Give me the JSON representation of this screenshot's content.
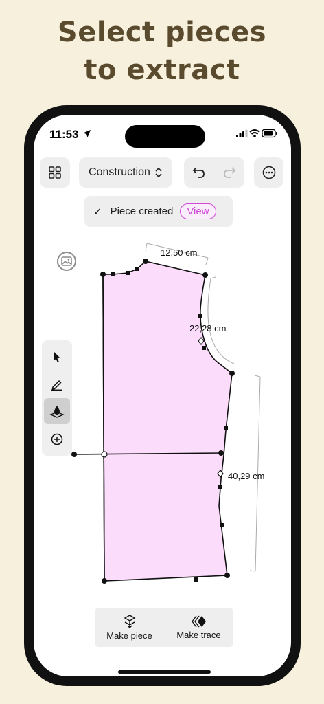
{
  "headline": {
    "line1": "Select pieces",
    "line2": "to extract"
  },
  "status_bar": {
    "time": "11:53"
  },
  "toolbar": {
    "mode_label": "Construction"
  },
  "toast": {
    "message": "Piece created",
    "view_label": "View"
  },
  "measurements": {
    "shoulder": "12,50 cm",
    "armhole": "22,28 cm",
    "side": "40,29 cm"
  },
  "bottom_actions": {
    "make_piece": "Make piece",
    "make_trace": "Make trace"
  },
  "colors": {
    "accent": "#d24ad8",
    "piece_fill": "#fbdcfb",
    "headline": "#5a4a2e",
    "background": "#f6f0dc"
  },
  "icons": [
    "location-arrow-icon",
    "signal-icon",
    "wifi-icon",
    "battery-icon",
    "grid-icon",
    "chevron-updown-icon",
    "undo-icon",
    "redo-icon",
    "more-icon",
    "checkmark-icon",
    "image-icon",
    "pointer-icon",
    "pencil-icon",
    "fill-icon",
    "add-icon",
    "make-piece-icon",
    "make-trace-icon"
  ]
}
